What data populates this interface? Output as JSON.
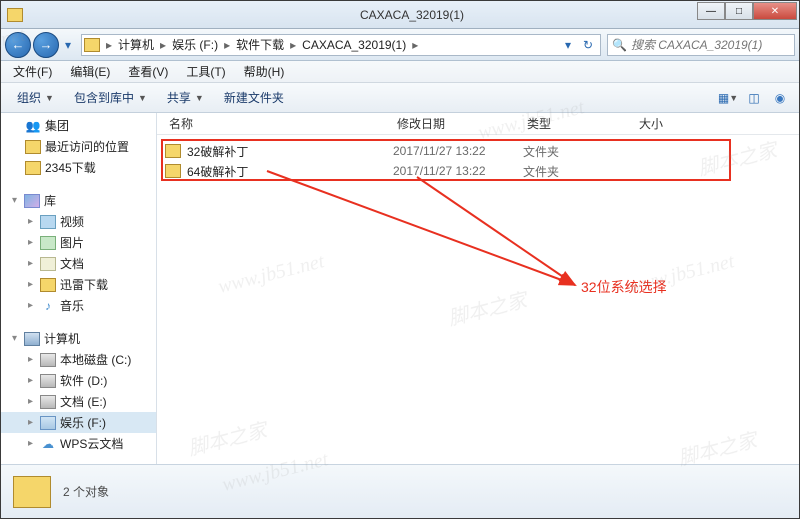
{
  "window": {
    "title": "CAXACA_32019(1)",
    "buttons": {
      "min": "—",
      "max": "□",
      "close": "✕"
    }
  },
  "nav": {
    "back": "←",
    "forward": "→",
    "dropdown": "▾",
    "refresh": "↻"
  },
  "breadcrumbs": [
    "计算机",
    "娱乐 (F:)",
    "软件下载",
    "CAXACA_32019(1)"
  ],
  "search": {
    "placeholder": "搜索 CAXACA_32019(1)"
  },
  "menu": [
    "文件(F)",
    "编辑(E)",
    "查看(V)",
    "工具(T)",
    "帮助(H)"
  ],
  "toolbar": {
    "organize": "组织",
    "include": "包含到库中",
    "share": "共享",
    "new_folder": "新建文件夹"
  },
  "sidebar": {
    "group1": [
      {
        "icon": "group",
        "label": "集团"
      },
      {
        "icon": "folder",
        "label": "最近访问的位置"
      },
      {
        "icon": "folder",
        "label": "2345下载"
      }
    ],
    "libs_header": "库",
    "libs": [
      {
        "icon": "video",
        "label": "视频"
      },
      {
        "icon": "pic",
        "label": "图片"
      },
      {
        "icon": "doc",
        "label": "文档"
      },
      {
        "icon": "folder",
        "label": "迅雷下载"
      },
      {
        "icon": "music",
        "label": "音乐"
      }
    ],
    "computer_header": "计算机",
    "drives": [
      {
        "label": "本地磁盘 (C:)"
      },
      {
        "label": "软件 (D:)"
      },
      {
        "label": "文档 (E:)"
      },
      {
        "label": "娱乐 (F:)",
        "selected": true
      },
      {
        "label": "WPS云文档",
        "cloud": true
      }
    ]
  },
  "columns": {
    "name": "名称",
    "date": "修改日期",
    "type": "类型",
    "size": "大小"
  },
  "files": [
    {
      "name": "32破解补丁",
      "date": "2017/11/27 13:22",
      "type": "文件夹"
    },
    {
      "name": "64破解补丁",
      "date": "2017/11/27 13:22",
      "type": "文件夹"
    }
  ],
  "annotation": "32位系统选择",
  "status": "2 个对象",
  "watermarks": [
    "www.jb51.net",
    "脚本之家",
    "www.jb51.net",
    "脚本之家",
    "www.jb51.net",
    "脚本之家",
    "脚本之家"
  ]
}
